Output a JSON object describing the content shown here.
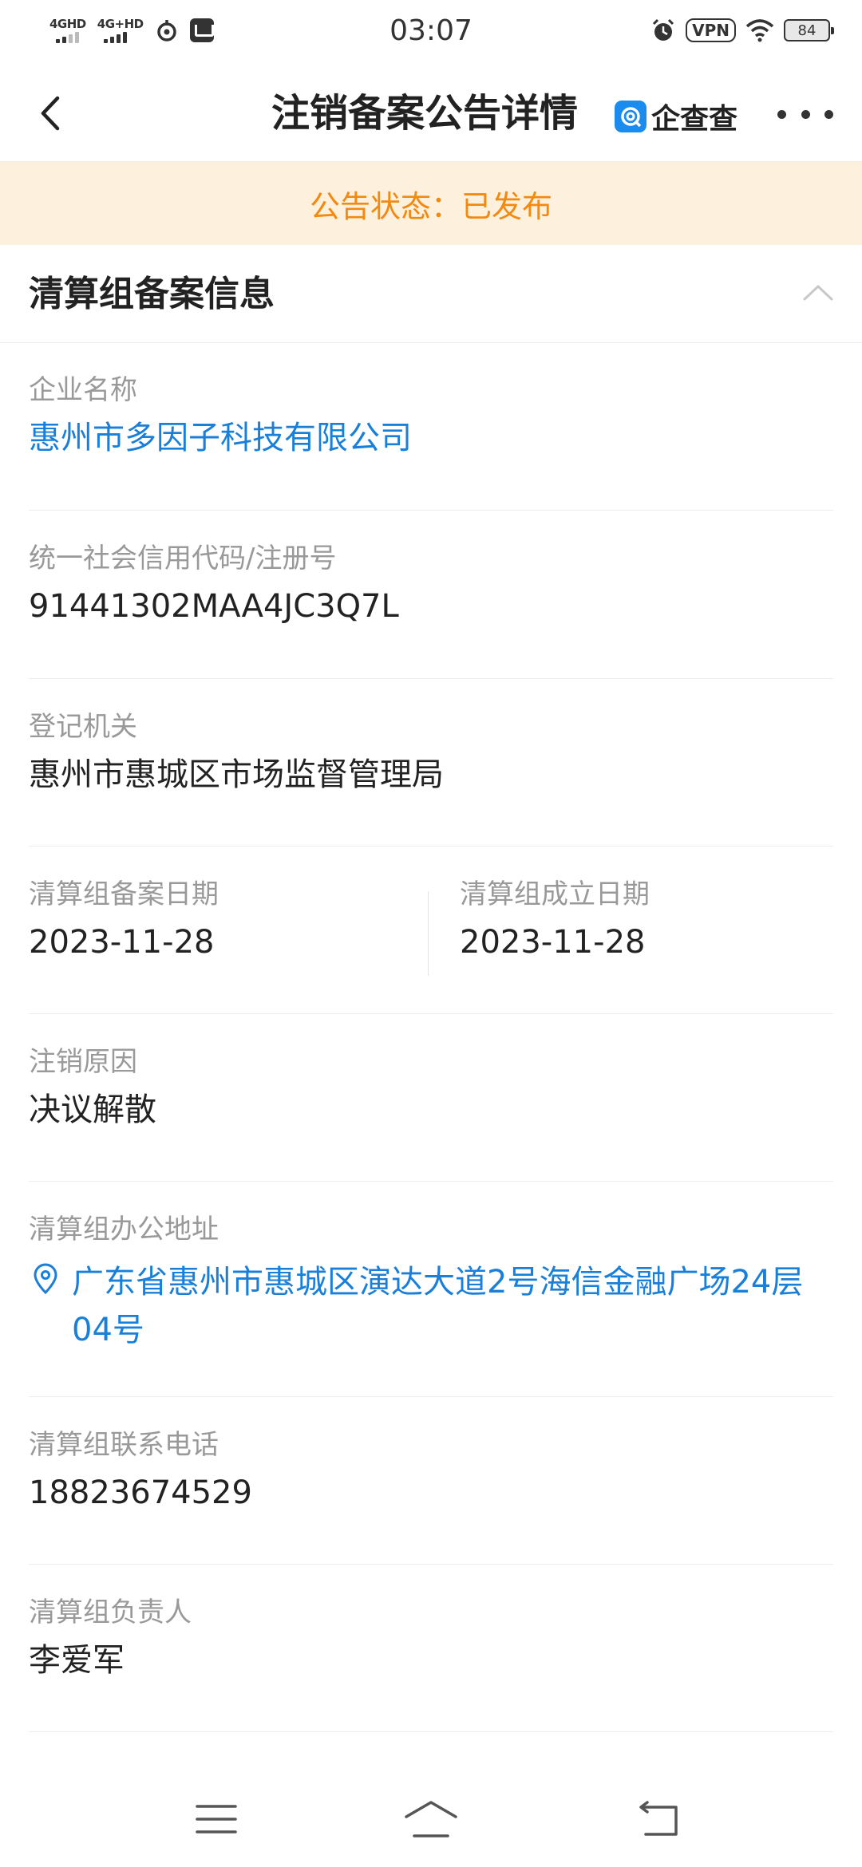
{
  "status_bar": {
    "signal1_label": "4GHD",
    "signal2_label": "4G+HD",
    "time": "03:07",
    "vpn": "VPN",
    "battery": "84",
    "icons": [
      "signal-icon",
      "signal-icon",
      "data-saver-icon",
      "notification-icon",
      "alarm-icon",
      "wifi-icon",
      "battery-icon"
    ]
  },
  "header": {
    "title": "注销备案公告详情",
    "brand": "企查查",
    "icons": [
      "back-icon",
      "brand-logo-icon",
      "more-icon"
    ]
  },
  "banner": {
    "text": "公告状态：已发布"
  },
  "section": {
    "title": "清算组备案信息",
    "icon": "chevron-up-icon"
  },
  "fields": {
    "company": {
      "label": "企业名称",
      "value": "惠州市多因子科技有限公司"
    },
    "credit_code": {
      "label": "统一社会信用代码/注册号",
      "value": "91441302MAA4JC3Q7L"
    },
    "authority": {
      "label": "登记机关",
      "value": "惠州市惠城区市场监督管理局"
    },
    "filing_date": {
      "label": "清算组备案日期",
      "value": "2023-11-28"
    },
    "established_date": {
      "label": "清算组成立日期",
      "value": "2023-11-28"
    },
    "reason": {
      "label": "注销原因",
      "value": "决议解散"
    },
    "address": {
      "label": "清算组办公地址",
      "value": "广东省惠州市惠城区演达大道2号海信金融广场24层04号",
      "icon": "location-pin-icon"
    },
    "phone": {
      "label": "清算组联系电话",
      "value": "18823674529"
    },
    "leader": {
      "label": "清算组负责人",
      "value": "李爱军"
    }
  },
  "colors": {
    "link": "#1a7fd9",
    "banner_bg": "#fdf0dc",
    "banner_text": "#f28a12",
    "brand_blue": "#1a8cf0"
  },
  "nav_bar": {
    "icons": [
      "menu-icon",
      "home-icon",
      "back-nav-icon"
    ]
  }
}
